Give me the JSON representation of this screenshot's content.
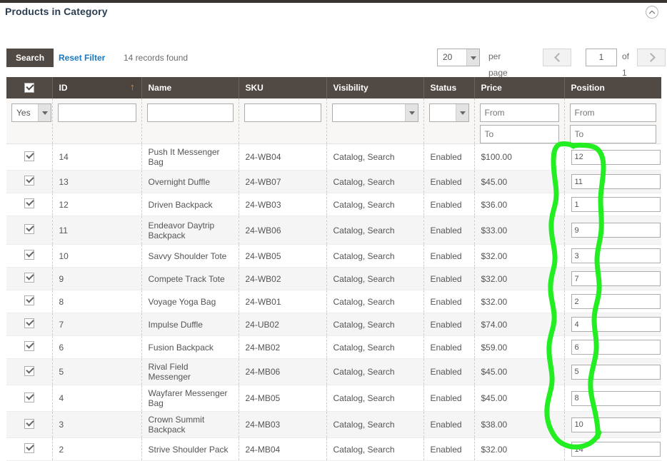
{
  "section": {
    "title": "Products in Category",
    "collapse_icon": "chevron-up-circle-icon"
  },
  "toolbar": {
    "search_label": "Search",
    "reset_filter_label": "Reset Filter",
    "records_found": "14 records found"
  },
  "pager": {
    "per_page_value": "20",
    "per_page_label": "per page",
    "prev_icon": "chevron-left-icon",
    "next_icon": "chevron-right-icon",
    "current_page": "1",
    "of_label": "of 1"
  },
  "grid": {
    "columns": [
      {
        "key": "check",
        "label": "",
        "sorted": false
      },
      {
        "key": "id",
        "label": "ID",
        "sorted": true,
        "sort_dir": "asc",
        "sort_glyph": "↑"
      },
      {
        "key": "name",
        "label": "Name",
        "sorted": false
      },
      {
        "key": "sku",
        "label": "SKU",
        "sorted": false
      },
      {
        "key": "visibility",
        "label": "Visibility",
        "sorted": false
      },
      {
        "key": "status",
        "label": "Status",
        "sorted": false
      },
      {
        "key": "price",
        "label": "Price",
        "sorted": false
      },
      {
        "key": "position",
        "label": "Position",
        "sorted": false
      }
    ],
    "filters": {
      "check_select_value": "Yes",
      "id_value": "",
      "name_value": "",
      "sku_value": "",
      "visibility_value": "",
      "status_value": "",
      "price_from_placeholder": "From",
      "price_to_placeholder": "To",
      "position_from_placeholder": "From",
      "position_to_placeholder": "To"
    },
    "rows": [
      {
        "checked": true,
        "id": "14",
        "name": "Push It Messenger Bag",
        "sku": "24-WB04",
        "visibility": "Catalog, Search",
        "status": "Enabled",
        "price": "$100.00",
        "position": "12"
      },
      {
        "checked": true,
        "id": "13",
        "name": "Overnight Duffle",
        "sku": "24-WB07",
        "visibility": "Catalog, Search",
        "status": "Enabled",
        "price": "$45.00",
        "position": "11"
      },
      {
        "checked": true,
        "id": "12",
        "name": "Driven Backpack",
        "sku": "24-WB03",
        "visibility": "Catalog, Search",
        "status": "Enabled",
        "price": "$36.00",
        "position": "1"
      },
      {
        "checked": true,
        "id": "11",
        "name": "Endeavor Daytrip Backpack",
        "sku": "24-WB06",
        "visibility": "Catalog, Search",
        "status": "Enabled",
        "price": "$33.00",
        "position": "9",
        "tall": true
      },
      {
        "checked": true,
        "id": "10",
        "name": "Savvy Shoulder Tote",
        "sku": "24-WB05",
        "visibility": "Catalog, Search",
        "status": "Enabled",
        "price": "$32.00",
        "position": "3"
      },
      {
        "checked": true,
        "id": "9",
        "name": "Compete Track Tote",
        "sku": "24-WB02",
        "visibility": "Catalog, Search",
        "status": "Enabled",
        "price": "$32.00",
        "position": "7"
      },
      {
        "checked": true,
        "id": "8",
        "name": "Voyage Yoga Bag",
        "sku": "24-WB01",
        "visibility": "Catalog, Search",
        "status": "Enabled",
        "price": "$32.00",
        "position": "2"
      },
      {
        "checked": true,
        "id": "7",
        "name": "Impulse Duffle",
        "sku": "24-UB02",
        "visibility": "Catalog, Search",
        "status": "Enabled",
        "price": "$74.00",
        "position": "4"
      },
      {
        "checked": true,
        "id": "6",
        "name": "Fusion Backpack",
        "sku": "24-MB02",
        "visibility": "Catalog, Search",
        "status": "Enabled",
        "price": "$59.00",
        "position": "6"
      },
      {
        "checked": true,
        "id": "5",
        "name": "Rival Field Messenger",
        "sku": "24-MB06",
        "visibility": "Catalog, Search",
        "status": "Enabled",
        "price": "$45.00",
        "position": "5"
      },
      {
        "checked": true,
        "id": "4",
        "name": "Wayfarer Messenger Bag",
        "sku": "24-MB05",
        "visibility": "Catalog, Search",
        "status": "Enabled",
        "price": "$45.00",
        "position": "8"
      },
      {
        "checked": true,
        "id": "3",
        "name": "Crown Summit Backpack",
        "sku": "24-MB03",
        "visibility": "Catalog, Search",
        "status": "Enabled",
        "price": "$38.00",
        "position": "10"
      },
      {
        "checked": true,
        "id": "2",
        "name": "Strive Shoulder Pack",
        "sku": "24-MB04",
        "visibility": "Catalog, Search",
        "status": "Enabled",
        "price": "$32.00",
        "position": "14"
      }
    ]
  },
  "annotation": {
    "type": "freehand-loop",
    "color": "#22ee22",
    "target": "position-column-inputs"
  },
  "colors": {
    "header_bg": "#514943",
    "accent_link": "#1979c3",
    "sort_arrow": "#f09030",
    "title_text": "#2b3d51",
    "row_alt_bg": "#f5f5f5",
    "annotation_green": "#22ee22"
  }
}
